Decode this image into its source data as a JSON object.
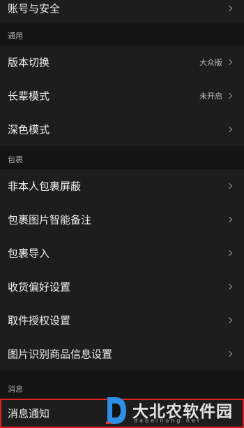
{
  "rows": {
    "account_security": "账号与安全",
    "version_switch": {
      "label": "版本切换",
      "value": "大众版"
    },
    "elder_mode": {
      "label": "长辈模式",
      "value": "未开启"
    },
    "dark_mode": "深色模式",
    "block_non_self": "非本人包裹屏蔽",
    "smart_note": "包裹图片智能备注",
    "import_package": "包裹导入",
    "delivery_pref": "收货偏好设置",
    "pickup_auth": "取件授权设置",
    "image_recognition": "图片识别商品信息设置",
    "message_notify": "消息通知"
  },
  "sections": {
    "general": "通用",
    "package": "包裹",
    "message": "消息"
  },
  "watermark": {
    "title": "大北农软件园",
    "subtitle": "dabeinong.net"
  },
  "colors": {
    "background": "#141414",
    "row_background": "#1d1d1d",
    "highlight_border": "#e02020",
    "logo_blue": "#2f8ee6"
  }
}
